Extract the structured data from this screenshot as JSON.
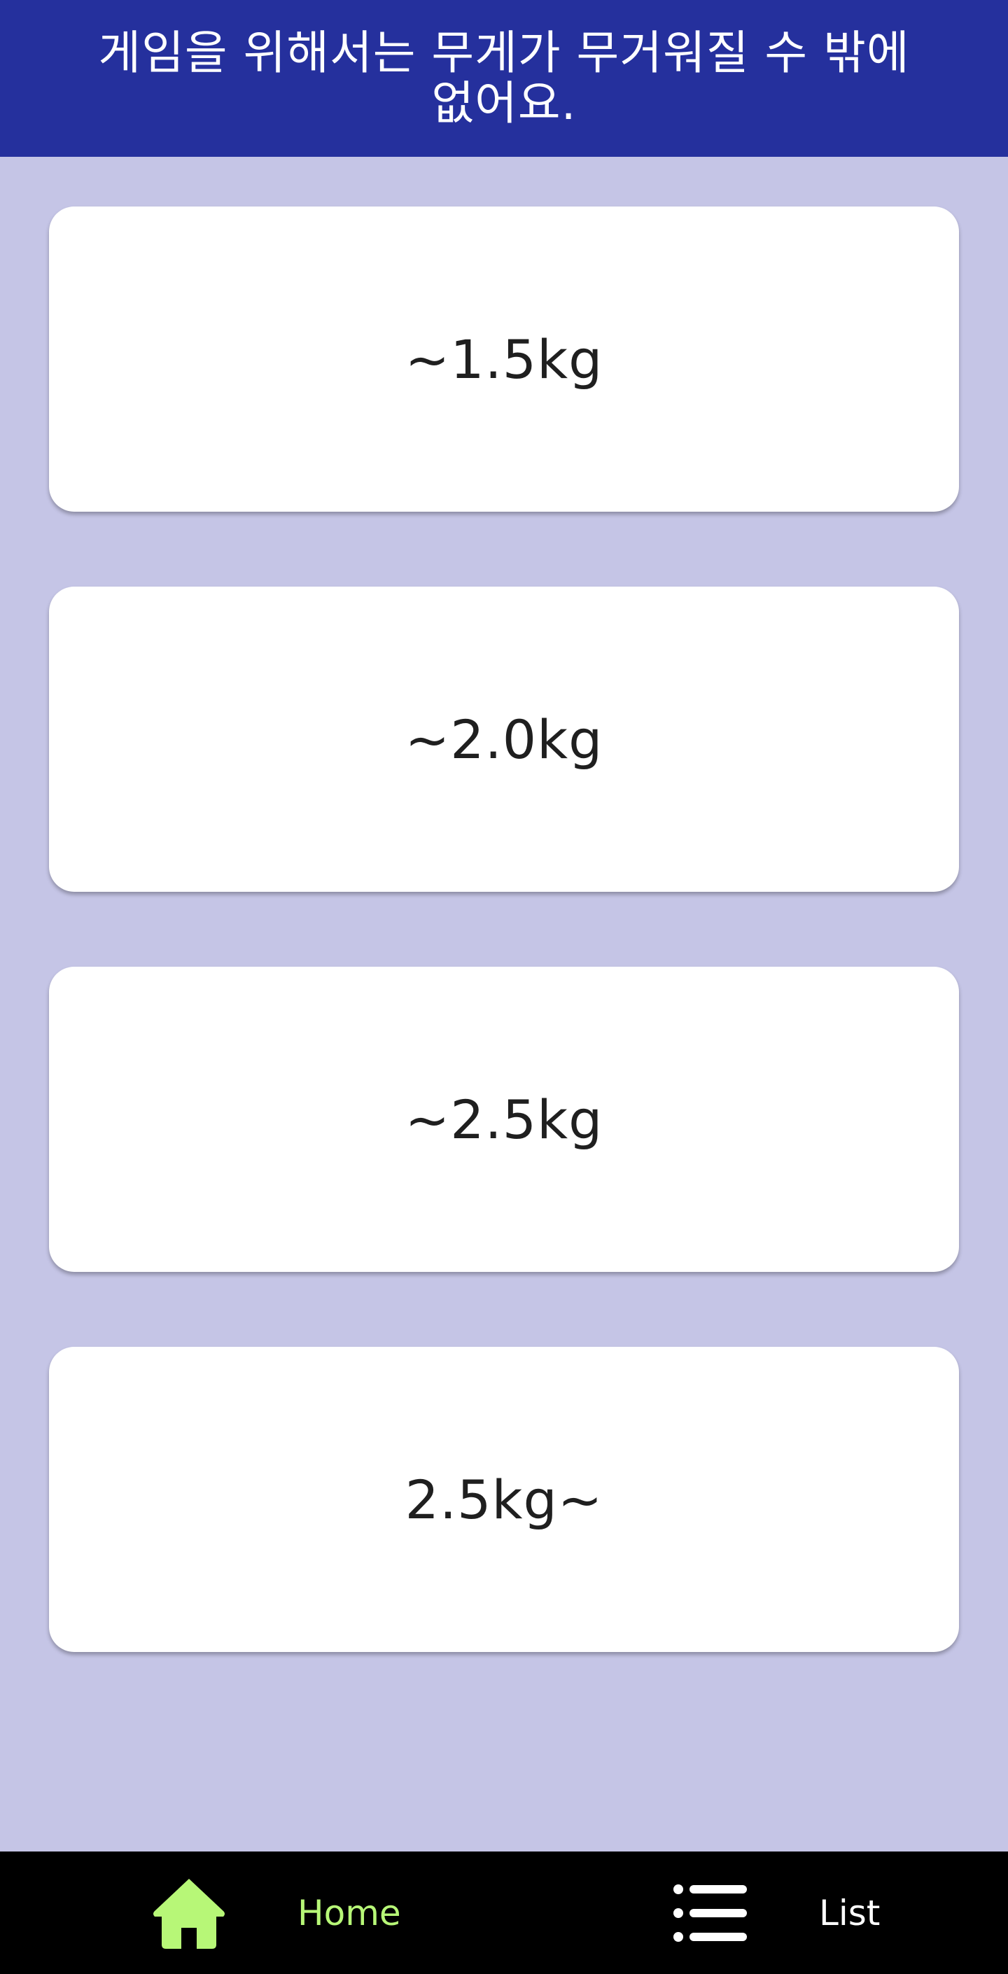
{
  "header": {
    "title": "게임을 위해서는 무게가 무거워질 수 밖에 없어요."
  },
  "options": [
    {
      "label": "~1.5kg"
    },
    {
      "label": "~2.0kg"
    },
    {
      "label": "~2.5kg"
    },
    {
      "label": "2.5kg~"
    }
  ],
  "bottom_nav": {
    "home": {
      "label": "Home",
      "icon": "home-icon",
      "active": true,
      "color": "#b7f777"
    },
    "list": {
      "label": "List",
      "icon": "list-icon",
      "active": false,
      "color": "#ffffff"
    }
  },
  "colors": {
    "header_bg": "#25309d",
    "page_bg": "#c5c5e6",
    "nav_bg": "#000000",
    "active_accent": "#b7f777"
  }
}
